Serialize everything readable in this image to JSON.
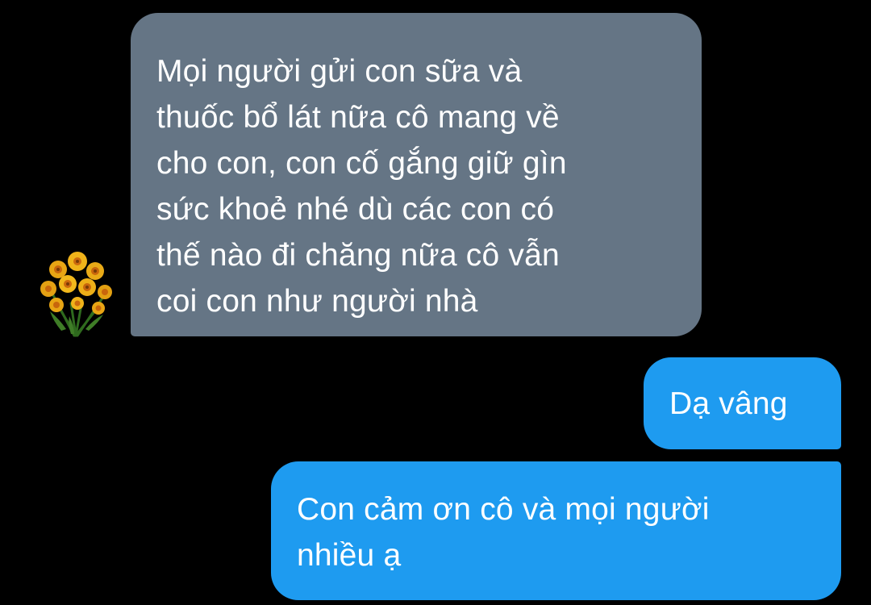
{
  "conversation": {
    "incoming": {
      "lines": [
        "Mọi người gửi con sữa và",
        "thuốc bổ lát nữa cô mang về",
        "cho con, con cố gắng giữ gìn",
        "sức khoẻ nhé dù các con có",
        "thế nào đi chăng nữa cô vẫn",
        "coi con như người nhà"
      ],
      "avatar_icon": "yellow-flower-bouquet-icon",
      "bubble_color": "#657585"
    },
    "outgoing": [
      {
        "lines": [
          "Dạ vâng"
        ]
      },
      {
        "lines": [
          "Con cảm ơn cô và mọi người",
          "nhiều ạ"
        ]
      }
    ],
    "outgoing_bubble_color": "#1e9bf0",
    "background_color": "#000000"
  }
}
